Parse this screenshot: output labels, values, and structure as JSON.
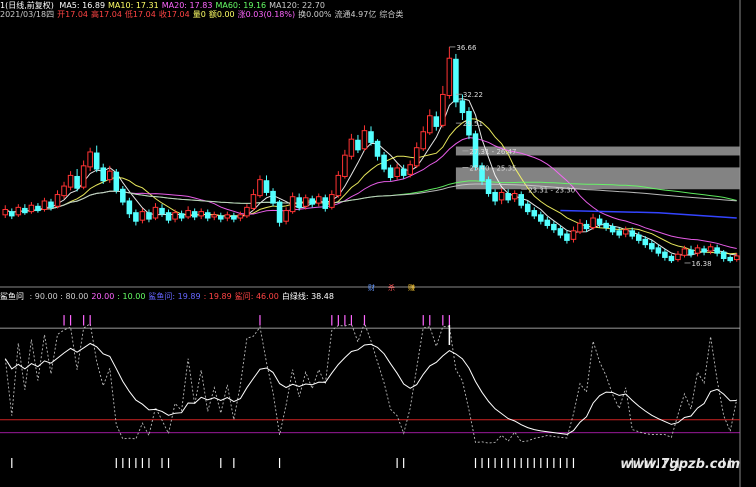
{
  "header": {
    "title": "1(日线,前复权)",
    "ma_items": [
      {
        "label": "MA5: 16.89",
        "color": "#ffffff"
      },
      {
        "label": "MA10: 17.31",
        "color": "#ffff66"
      },
      {
        "label": "MA20: 17.83",
        "color": "#ff66ff"
      },
      {
        "label": "MA60: 19.16",
        "color": "#66ff66"
      },
      {
        "label": "MA120: 22.70",
        "color": "#cccccc"
      }
    ],
    "quote_items": [
      {
        "label": "2021/03/18四",
        "color": "#cccccc"
      },
      {
        "label": "开17.04",
        "color": "#ff4444"
      },
      {
        "label": "高17.04",
        "color": "#ff4444"
      },
      {
        "label": "低17.04",
        "color": "#ff4444"
      },
      {
        "label": "收17.04",
        "color": "#ff4444"
      },
      {
        "label": "量0",
        "color": "#ffff66"
      },
      {
        "label": "额0.00",
        "color": "#ffff66"
      },
      {
        "label": "涨0.03(0.18%)",
        "color": "#ff66ff"
      },
      {
        "label": "换0.00%",
        "color": "#cccccc"
      },
      {
        "label": "流通4.97亿",
        "color": "#cccccc"
      },
      {
        "label": "综合类",
        "color": "#cccccc"
      }
    ]
  },
  "price_annotations": [
    {
      "text": "36.66",
      "color": "#dddddd"
    },
    {
      "text": "32.22",
      "color": "#dddddd"
    },
    {
      "text": "29.51",
      "color": "#dddddd"
    },
    {
      "text": "27.31 - 26.47",
      "color": "#dddddd"
    },
    {
      "text": "25.40 - 25.35",
      "color": "#dddddd"
    },
    {
      "text": "23.31 - 23.30",
      "color": "#dddddd"
    },
    {
      "text": "16.38",
      "color": "#dddddd"
    }
  ],
  "signal_labels": [
    {
      "text": "财",
      "color": "#6699ff"
    },
    {
      "text": "杀",
      "color": "#ff5555"
    },
    {
      "text": "赚",
      "color": "#ffcc33"
    }
  ],
  "indicator": {
    "title": "鲨鱼问",
    "params": [
      {
        "label": ": 90.00 : 80.00",
        "color": "#cccccc"
      },
      {
        "label": "20.00",
        "color": "#ff66ff"
      },
      {
        "label": ": 10.00",
        "color": "#66ff66"
      },
      {
        "label": "鲨鱼问: 19.89",
        "color": "#6666ff"
      },
      {
        "label": ": 19.89",
        "color": "#ff4444"
      },
      {
        "label": "鲨问: 46.00",
        "color": "#ff4444"
      },
      {
        "label": "白绿线: 38.48",
        "color": "#ffffff"
      }
    ]
  },
  "watermark": "www.7gpzb.com",
  "chart_data": {
    "type": "candlestick",
    "price_range_visible": [
      14.5,
      39.0
    ],
    "candles": [
      {
        "o": 20.9,
        "c": 21.4,
        "h": 21.8,
        "l": 20.6
      },
      {
        "o": 21.2,
        "c": 20.8,
        "h": 21.5,
        "l": 20.5
      },
      {
        "o": 20.9,
        "c": 21.6,
        "h": 21.9,
        "l": 20.7
      },
      {
        "o": 21.5,
        "c": 21.1,
        "h": 21.9,
        "l": 20.9
      },
      {
        "o": 21.2,
        "c": 21.8,
        "h": 22.1,
        "l": 21.0
      },
      {
        "o": 21.7,
        "c": 21.3,
        "h": 22.0,
        "l": 21.1
      },
      {
        "o": 21.4,
        "c": 22.2,
        "h": 22.5,
        "l": 21.2
      },
      {
        "o": 22.1,
        "c": 21.6,
        "h": 22.4,
        "l": 21.3
      },
      {
        "o": 21.7,
        "c": 22.8,
        "h": 23.2,
        "l": 21.5
      },
      {
        "o": 22.7,
        "c": 23.6,
        "h": 24.0,
        "l": 22.4
      },
      {
        "o": 23.5,
        "c": 24.6,
        "h": 25.0,
        "l": 23.2
      },
      {
        "o": 24.5,
        "c": 23.4,
        "h": 25.2,
        "l": 23.1
      },
      {
        "o": 23.5,
        "c": 25.5,
        "h": 26.0,
        "l": 23.3
      },
      {
        "o": 25.4,
        "c": 26.8,
        "h": 27.2,
        "l": 25.0
      },
      {
        "o": 26.7,
        "c": 25.2,
        "h": 27.4,
        "l": 24.9
      },
      {
        "o": 25.3,
        "c": 24.1,
        "h": 25.7,
        "l": 23.8
      },
      {
        "o": 24.2,
        "c": 25.0,
        "h": 25.5,
        "l": 23.9
      },
      {
        "o": 24.9,
        "c": 23.2,
        "h": 25.2,
        "l": 22.9
      },
      {
        "o": 23.3,
        "c": 22.1,
        "h": 23.6,
        "l": 21.8
      },
      {
        "o": 22.2,
        "c": 21.0,
        "h": 22.5,
        "l": 20.6
      },
      {
        "o": 21.1,
        "c": 20.3,
        "h": 21.4,
        "l": 19.9
      },
      {
        "o": 20.4,
        "c": 21.2,
        "h": 21.5,
        "l": 20.1
      },
      {
        "o": 21.1,
        "c": 20.5,
        "h": 21.4,
        "l": 20.2
      },
      {
        "o": 20.6,
        "c": 21.6,
        "h": 22.0,
        "l": 20.4
      },
      {
        "o": 21.5,
        "c": 21.0,
        "h": 21.9,
        "l": 20.7
      },
      {
        "o": 21.1,
        "c": 20.4,
        "h": 21.4,
        "l": 20.1
      },
      {
        "o": 20.5,
        "c": 21.1,
        "h": 21.4,
        "l": 20.2
      },
      {
        "o": 21.0,
        "c": 20.6,
        "h": 21.3,
        "l": 20.3
      },
      {
        "o": 20.7,
        "c": 21.3,
        "h": 21.7,
        "l": 20.5
      },
      {
        "o": 21.2,
        "c": 20.7,
        "h": 21.5,
        "l": 20.4
      },
      {
        "o": 20.8,
        "c": 21.2,
        "h": 21.5,
        "l": 20.5
      },
      {
        "o": 21.1,
        "c": 20.6,
        "h": 21.4,
        "l": 20.3
      },
      {
        "o": 20.7,
        "c": 20.9,
        "h": 21.2,
        "l": 20.4
      },
      {
        "o": 20.8,
        "c": 20.5,
        "h": 21.1,
        "l": 20.2
      },
      {
        "o": 20.6,
        "c": 20.9,
        "h": 21.2,
        "l": 20.3
      },
      {
        "o": 20.8,
        "c": 20.5,
        "h": 21.1,
        "l": 20.2
      },
      {
        "o": 20.6,
        "c": 20.9,
        "h": 21.2,
        "l": 20.3
      },
      {
        "o": 20.8,
        "c": 21.6,
        "h": 21.9,
        "l": 20.6
      },
      {
        "o": 21.5,
        "c": 22.8,
        "h": 23.3,
        "l": 21.3
      },
      {
        "o": 22.7,
        "c": 24.2,
        "h": 24.6,
        "l": 22.5
      },
      {
        "o": 24.1,
        "c": 23.0,
        "h": 24.6,
        "l": 22.7
      },
      {
        "o": 23.1,
        "c": 22.0,
        "h": 23.4,
        "l": 21.7
      },
      {
        "o": 22.1,
        "c": 20.2,
        "h": 22.3,
        "l": 19.8
      },
      {
        "o": 20.3,
        "c": 21.3,
        "h": 21.6,
        "l": 20.0
      },
      {
        "o": 21.2,
        "c": 22.6,
        "h": 23.0,
        "l": 21.0
      },
      {
        "o": 22.5,
        "c": 21.6,
        "h": 22.9,
        "l": 21.3
      },
      {
        "o": 21.7,
        "c": 22.5,
        "h": 22.8,
        "l": 21.4
      },
      {
        "o": 22.4,
        "c": 21.9,
        "h": 22.7,
        "l": 21.6
      },
      {
        "o": 22.0,
        "c": 22.6,
        "h": 22.9,
        "l": 21.7
      },
      {
        "o": 22.5,
        "c": 21.5,
        "h": 22.8,
        "l": 21.2
      },
      {
        "o": 21.6,
        "c": 22.8,
        "h": 23.2,
        "l": 21.4
      },
      {
        "o": 22.7,
        "c": 24.6,
        "h": 25.0,
        "l": 22.5
      },
      {
        "o": 24.5,
        "c": 26.5,
        "h": 27.0,
        "l": 24.3
      },
      {
        "o": 26.4,
        "c": 28.0,
        "h": 28.5,
        "l": 26.1
      },
      {
        "o": 27.9,
        "c": 27.0,
        "h": 28.4,
        "l": 26.7
      },
      {
        "o": 27.1,
        "c": 28.8,
        "h": 29.3,
        "l": 26.9
      },
      {
        "o": 28.7,
        "c": 27.7,
        "h": 29.2,
        "l": 27.4
      },
      {
        "o": 27.8,
        "c": 26.4,
        "h": 28.0,
        "l": 26.0
      },
      {
        "o": 26.5,
        "c": 25.2,
        "h": 26.8,
        "l": 24.9
      },
      {
        "o": 25.3,
        "c": 24.4,
        "h": 25.6,
        "l": 24.1
      },
      {
        "o": 24.5,
        "c": 25.3,
        "h": 25.7,
        "l": 24.2
      },
      {
        "o": 25.2,
        "c": 24.6,
        "h": 25.6,
        "l": 24.3
      },
      {
        "o": 24.7,
        "c": 25.6,
        "h": 26.0,
        "l": 24.4
      },
      {
        "o": 25.5,
        "c": 27.2,
        "h": 27.7,
        "l": 25.3
      },
      {
        "o": 27.1,
        "c": 28.7,
        "h": 29.2,
        "l": 26.9
      },
      {
        "o": 28.6,
        "c": 30.2,
        "h": 30.8,
        "l": 28.4
      },
      {
        "o": 30.1,
        "c": 29.2,
        "h": 30.6,
        "l": 28.8
      },
      {
        "o": 29.3,
        "c": 32.2,
        "h": 33.0,
        "l": 29.1
      },
      {
        "o": 32.1,
        "c": 35.6,
        "h": 36.66,
        "l": 31.8
      },
      {
        "o": 35.5,
        "c": 31.5,
        "h": 36.0,
        "l": 31.0
      },
      {
        "o": 31.6,
        "c": 30.5,
        "h": 32.2,
        "l": 29.8
      },
      {
        "o": 30.6,
        "c": 28.4,
        "h": 31.0,
        "l": 28.0
      },
      {
        "o": 28.5,
        "c": 25.4,
        "h": 28.8,
        "l": 25.1
      },
      {
        "o": 25.5,
        "c": 24.1,
        "h": 25.8,
        "l": 23.7
      },
      {
        "o": 24.2,
        "c": 22.9,
        "h": 24.5,
        "l": 22.6
      },
      {
        "o": 23.0,
        "c": 22.2,
        "h": 23.3,
        "l": 21.8
      },
      {
        "o": 22.3,
        "c": 23.0,
        "h": 23.4,
        "l": 21.9
      },
      {
        "o": 22.9,
        "c": 22.3,
        "h": 23.3,
        "l": 22.0
      },
      {
        "o": 22.4,
        "c": 22.9,
        "h": 23.2,
        "l": 22.1
      },
      {
        "o": 22.8,
        "c": 21.8,
        "h": 23.1,
        "l": 21.5
      },
      {
        "o": 21.9,
        "c": 21.2,
        "h": 22.2,
        "l": 20.9
      },
      {
        "o": 21.3,
        "c": 20.8,
        "h": 21.6,
        "l": 20.5
      },
      {
        "o": 20.9,
        "c": 20.3,
        "h": 21.2,
        "l": 20.0
      },
      {
        "o": 20.4,
        "c": 19.9,
        "h": 20.7,
        "l": 19.6
      },
      {
        "o": 20.0,
        "c": 19.5,
        "h": 20.3,
        "l": 19.2
      },
      {
        "o": 19.6,
        "c": 19.0,
        "h": 19.9,
        "l": 18.7
      },
      {
        "o": 19.1,
        "c": 18.5,
        "h": 19.4,
        "l": 18.2
      },
      {
        "o": 18.6,
        "c": 19.4,
        "h": 19.8,
        "l": 18.3
      },
      {
        "o": 19.3,
        "c": 20.1,
        "h": 20.5,
        "l": 19.1
      },
      {
        "o": 20.0,
        "c": 19.6,
        "h": 20.4,
        "l": 19.3
      },
      {
        "o": 19.7,
        "c": 20.6,
        "h": 21.0,
        "l": 19.5
      },
      {
        "o": 20.5,
        "c": 20.0,
        "h": 20.9,
        "l": 19.7
      },
      {
        "o": 20.1,
        "c": 19.7,
        "h": 20.4,
        "l": 19.4
      },
      {
        "o": 19.8,
        "c": 19.3,
        "h": 20.1,
        "l": 19.0
      },
      {
        "o": 19.4,
        "c": 19.0,
        "h": 19.7,
        "l": 18.7
      },
      {
        "o": 19.1,
        "c": 19.5,
        "h": 19.8,
        "l": 18.8
      },
      {
        "o": 19.4,
        "c": 18.9,
        "h": 19.7,
        "l": 18.6
      },
      {
        "o": 19.0,
        "c": 18.5,
        "h": 19.3,
        "l": 18.2
      },
      {
        "o": 18.6,
        "c": 18.1,
        "h": 18.9,
        "l": 17.8
      },
      {
        "o": 18.2,
        "c": 17.7,
        "h": 18.5,
        "l": 17.4
      },
      {
        "o": 17.8,
        "c": 17.3,
        "h": 18.1,
        "l": 17.0
      },
      {
        "o": 17.4,
        "c": 16.9,
        "h": 17.7,
        "l": 16.6
      },
      {
        "o": 17.0,
        "c": 16.6,
        "h": 17.2,
        "l": 16.38
      },
      {
        "o": 16.7,
        "c": 17.2,
        "h": 17.5,
        "l": 16.5
      },
      {
        "o": 17.1,
        "c": 17.7,
        "h": 18.0,
        "l": 16.9
      },
      {
        "o": 17.6,
        "c": 17.2,
        "h": 18.0,
        "l": 16.9
      },
      {
        "o": 17.3,
        "c": 17.8,
        "h": 18.1,
        "l": 17.0
      },
      {
        "o": 17.7,
        "c": 17.4,
        "h": 18.0,
        "l": 17.1
      },
      {
        "o": 17.5,
        "c": 17.9,
        "h": 18.2,
        "l": 17.2
      },
      {
        "o": 17.8,
        "c": 17.3,
        "h": 18.1,
        "l": 17.0
      },
      {
        "o": 17.4,
        "c": 16.8,
        "h": 17.6,
        "l": 16.5
      },
      {
        "o": 16.9,
        "c": 16.6,
        "h": 17.1,
        "l": 16.4
      },
      {
        "o": 16.7,
        "c": 17.04,
        "h": 17.3,
        "l": 16.5
      }
    ],
    "resistance_zones": [
      [
        26.47,
        27.31
      ],
      [
        23.3,
        25.35
      ]
    ],
    "ma_periods": [
      5,
      10,
      20,
      60,
      120
    ],
    "ma_colors": [
      "#ffffff",
      "#ffff66",
      "#ff66ff",
      "#66ff66",
      "#cccccc"
    ],
    "indicator_levels": {
      "upper": 90,
      "lower": 10,
      "mid": 20
    },
    "indicator_range": [
      -20,
      110
    ]
  }
}
